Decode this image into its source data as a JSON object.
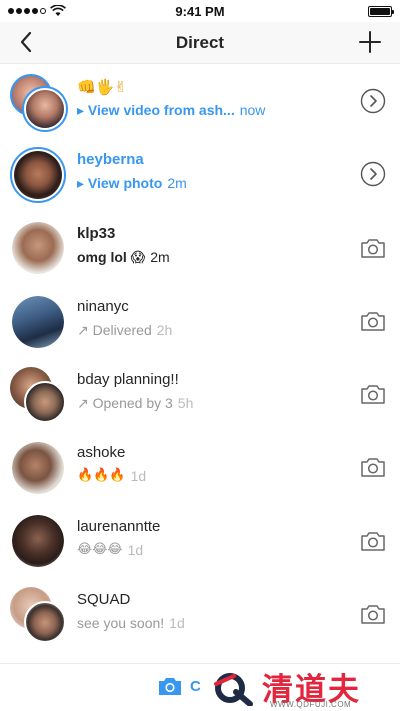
{
  "status_bar": {
    "time": "9:41 PM"
  },
  "nav": {
    "title": "Direct"
  },
  "threads": [
    {
      "name": "👊🖐✌",
      "message": "▸ View video from ash...",
      "time": "now"
    },
    {
      "name": "heyberna",
      "message": "▸ View photo",
      "time": "2m"
    },
    {
      "name": "klp33",
      "message": "omg lol 😱",
      "time": "2m"
    },
    {
      "name": "ninanyc",
      "message": "↗ Delivered",
      "time": "2h"
    },
    {
      "name": "bday planning!!",
      "message": "↗ Opened by 3",
      "time": "5h"
    },
    {
      "name": "ashoke",
      "message": "🔥🔥🔥",
      "time": "1d"
    },
    {
      "name": "laurenanntte",
      "message": "😂😂😂",
      "time": "1d"
    },
    {
      "name": "SQUAD",
      "message": "see you soon!",
      "time": "1d"
    }
  ],
  "bottom": {
    "camera_label": "C"
  },
  "watermark": {
    "name": "清道夫",
    "url": "WWW.QDFUJI.COM"
  },
  "colors": {
    "accent": "#3897f0",
    "text": "#262626",
    "muted": "#999999",
    "watermark_red": "#e2263d"
  },
  "icons": {
    "back": "chevron-left-icon",
    "new": "plus-icon",
    "open": "chevron-circle-right-icon",
    "camera": "camera-icon"
  }
}
